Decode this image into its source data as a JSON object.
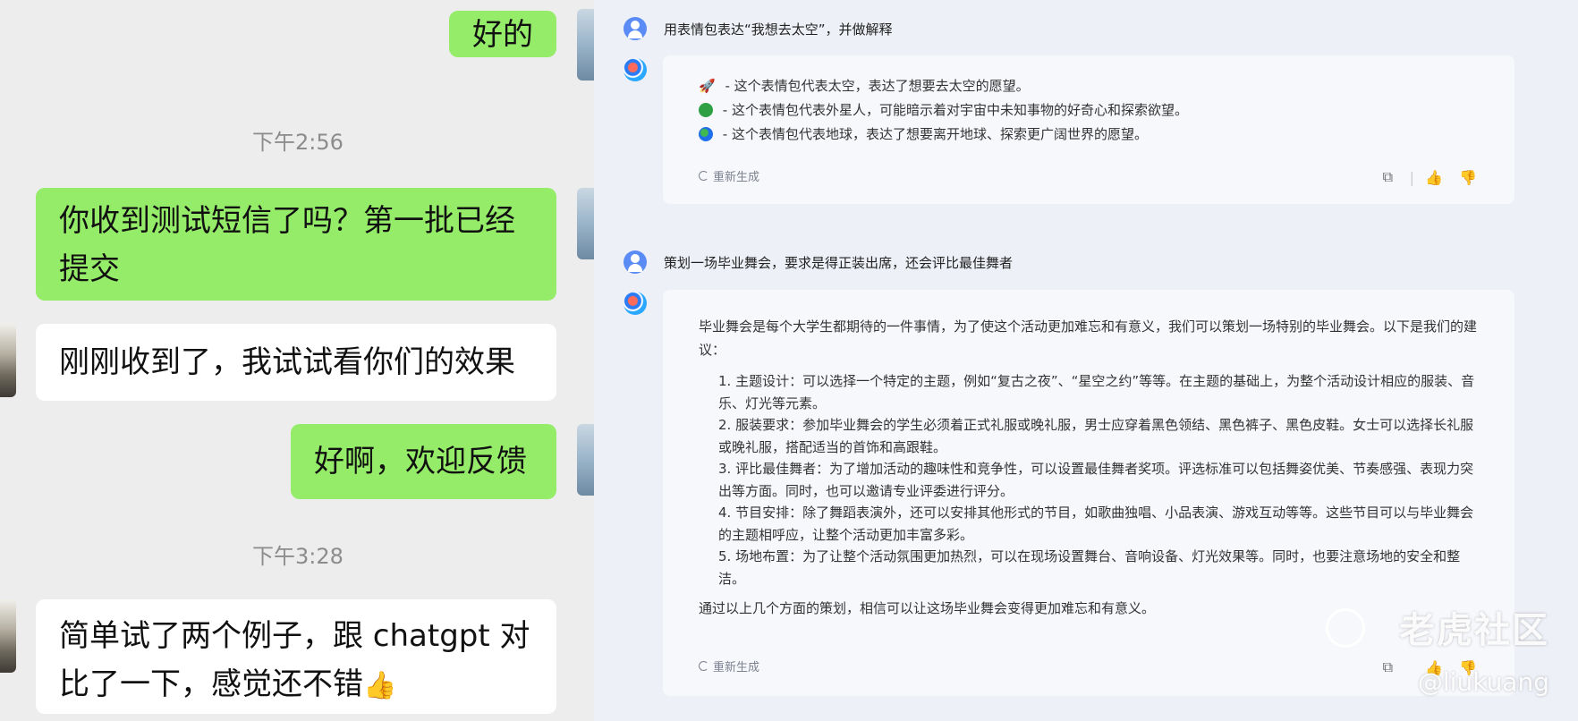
{
  "left_chat": {
    "messages": [
      {
        "dir": "sent",
        "text": "好的"
      },
      {
        "dir": "time",
        "text": "下午2:56"
      },
      {
        "dir": "sent",
        "text": "你收到测试短信了吗？第一批已经提交"
      },
      {
        "dir": "recv",
        "text": "刚刚收到了，我试试看你们的效果"
      },
      {
        "dir": "sent",
        "text": "好啊，欢迎反馈"
      },
      {
        "dir": "time",
        "text": "下午3:28"
      },
      {
        "dir": "recv",
        "text": "简单试了两个例子，跟 chatgpt 对比了一下，感觉还不错",
        "emoji": "👍"
      }
    ]
  },
  "right_chat": {
    "q1": "用表情包表达“我想去太空”，并做解释",
    "a1": [
      {
        "emoji": "🚀",
        "text": " - 这个表情包代表太空，表达了想要去太空的愿望。"
      },
      {
        "emoji": "👽",
        "text": " - 这个表情包代表外星人，可能暗示着对宇宙中未知事物的好奇心和探索欲望。"
      },
      {
        "emoji": "🌍",
        "text": " - 这个表情包代表地球，表达了想要离开地球、探索更广阔世界的愿望。"
      }
    ],
    "regen_label": "重新生成",
    "q2": "策划一场毕业舞会，要求是得正装出席，还会评比最佳舞者",
    "a2_intro": "毕业舞会是每个大学生都期待的一件事情，为了使这个活动更加难忘和有意义，我们可以策划一场特别的毕业舞会。以下是我们的建议：",
    "a2_list": [
      "1. 主题设计：可以选择一个特定的主题，例如“复古之夜”、“星空之约”等等。在主题的基础上，为整个活动设计相应的服装、音乐、灯光等元素。",
      "2. 服装要求：参加毕业舞会的学生必须着正式礼服或晚礼服，男士应穿着黑色领结、黑色裤子、黑色皮鞋。女士可以选择长礼服或晚礼服，搭配适当的首饰和高跟鞋。",
      "3. 评比最佳舞者：为了增加活动的趣味性和竞争性，可以设置最佳舞者奖项。评选标准可以包括舞姿优美、节奏感强、表现力突出等方面。同时，也可以邀请专业评委进行评分。",
      "4. 节目安排：除了舞蹈表演外，还可以安排其他形式的节目，如歌曲独唱、小品表演、游戏互动等等。这些节目可以与毕业舞会的主题相呼应，让整个活动更加丰富多彩。",
      "5. 场地布置：为了让整个活动氛围更加热烈，可以在现场设置舞台、音响设备、灯光效果等。同时，也要注意场地的安全和整洁。"
    ],
    "a2_outro": "通过以上几个方面的策划，相信可以让这场毕业舞会变得更加难忘和有意义。"
  },
  "watermark": {
    "brand": "老虎社区",
    "handle": "@liukuang"
  },
  "icons": {
    "copy": "copy-icon",
    "like": "thumbs-up-icon",
    "dislike": "thumbs-down-icon",
    "regen": "refresh-icon"
  },
  "colors": {
    "sent_bubble": "#95ec69",
    "recv_bubble": "#ffffff",
    "chat_bg": "#ededed",
    "ai_bg": "#eef0f7",
    "card_bg": "#f7f8fc"
  }
}
